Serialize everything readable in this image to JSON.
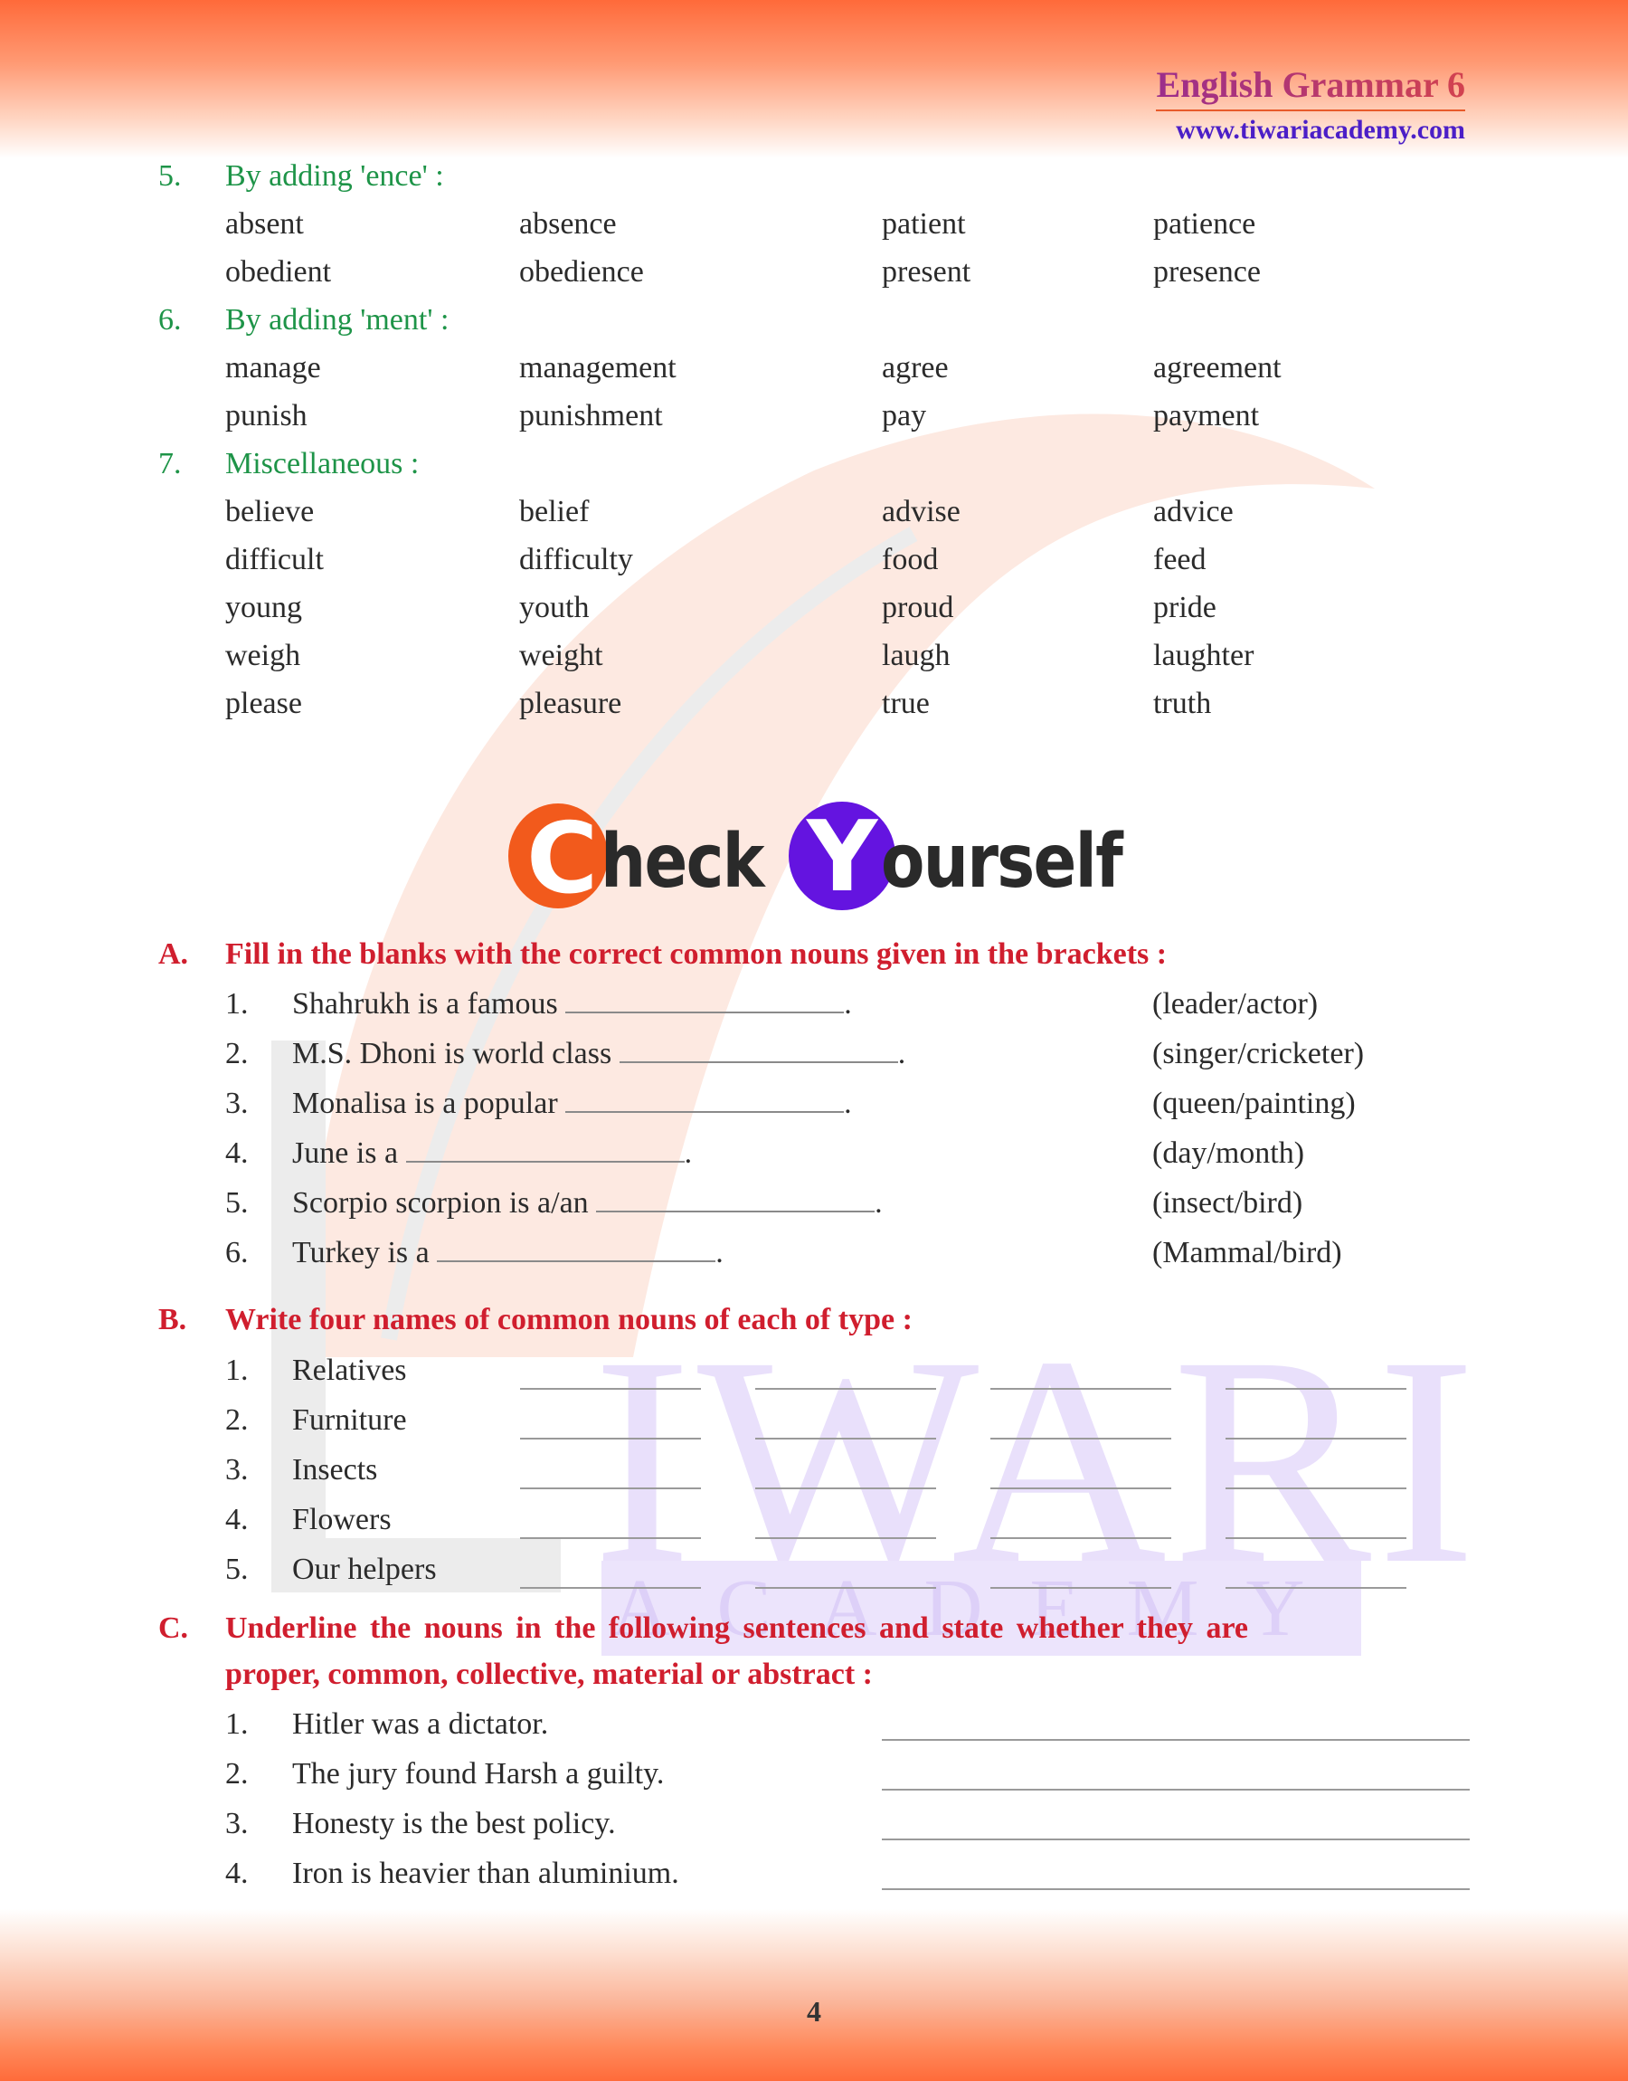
{
  "header": {
    "title": "English Grammar 6",
    "url": "www.tiwariacademy.com"
  },
  "watermark": {
    "main": "IWARI",
    "sub": "ACADEMY"
  },
  "sections": [
    {
      "num": "5.",
      "label": "By adding 'ence' :",
      "rows": [
        [
          "absent",
          "absence",
          "patient",
          "patience"
        ],
        [
          "obedient",
          "obedience",
          "present",
          "presence"
        ]
      ]
    },
    {
      "num": "6.",
      "label": "By adding 'ment' :",
      "rows": [
        [
          "manage",
          "management",
          "agree",
          "agreement"
        ],
        [
          "punish",
          "punishment",
          "pay",
          "payment"
        ]
      ]
    },
    {
      "num": "7.",
      "label": "Miscellaneous :",
      "rows": [
        [
          "believe",
          "belief",
          "advise",
          "advice"
        ],
        [
          "difficult",
          "difficulty",
          "food",
          "feed"
        ],
        [
          "young",
          "youth",
          "proud",
          "pride"
        ],
        [
          "weigh",
          "weight",
          "laugh",
          "laughter"
        ],
        [
          "please",
          "pleasure",
          "true",
          "truth"
        ]
      ]
    }
  ],
  "check_yourself": {
    "first_letter": "C",
    "first_rest": "heck",
    "second_letter": "Y",
    "second_rest": "ourself"
  },
  "exercise_a": {
    "num": "A.",
    "title": "Fill in the blanks with the correct common nouns given in the brackets :",
    "items": [
      {
        "n": "1.",
        "text": "Shahrukh is a famous",
        "end": ".",
        "options": "(leader/actor)"
      },
      {
        "n": "2.",
        "text": "M.S. Dhoni is world class",
        "end": ".",
        "options": "(singer/cricketer)"
      },
      {
        "n": "3.",
        "text": "Monalisa is a popular",
        "end": ".",
        "options": "(queen/painting)"
      },
      {
        "n": "4.",
        "text": "June is a",
        "end": ".",
        "options": "(day/month)"
      },
      {
        "n": "5.",
        "text": "Scorpio scorpion is a/an",
        "end": ".",
        "options": "(insect/bird)"
      },
      {
        "n": "6.",
        "text": "Turkey is a",
        "end": ".",
        "options": "(Mammal/bird)"
      }
    ]
  },
  "exercise_b": {
    "num": "B.",
    "title": "Write four names of common nouns of each of type :",
    "items": [
      {
        "n": "1.",
        "text": "Relatives"
      },
      {
        "n": "2.",
        "text": "Furniture"
      },
      {
        "n": "3.",
        "text": "Insects"
      },
      {
        "n": "4.",
        "text": "Flowers"
      },
      {
        "n": "5.",
        "text": "Our helpers"
      }
    ]
  },
  "exercise_c": {
    "num": "C.",
    "title_line1": "Underline the nouns in the following sentences and state whether they are",
    "title_line2": "proper, common, collective, material or abstract :",
    "items": [
      {
        "n": "1.",
        "text": "Hitler was a dictator."
      },
      {
        "n": "2.",
        "text": "The jury found Harsh a guilty."
      },
      {
        "n": "3.",
        "text": "Honesty is the best policy."
      },
      {
        "n": "4.",
        "text": "Iron is heavier than aluminium."
      }
    ]
  },
  "page_number": "4",
  "colors": {
    "heading_green": "#1e9448",
    "exercise_red": "#d01e2e",
    "brand_orange": "#f25a1c",
    "brand_purple": "#6414e0"
  }
}
